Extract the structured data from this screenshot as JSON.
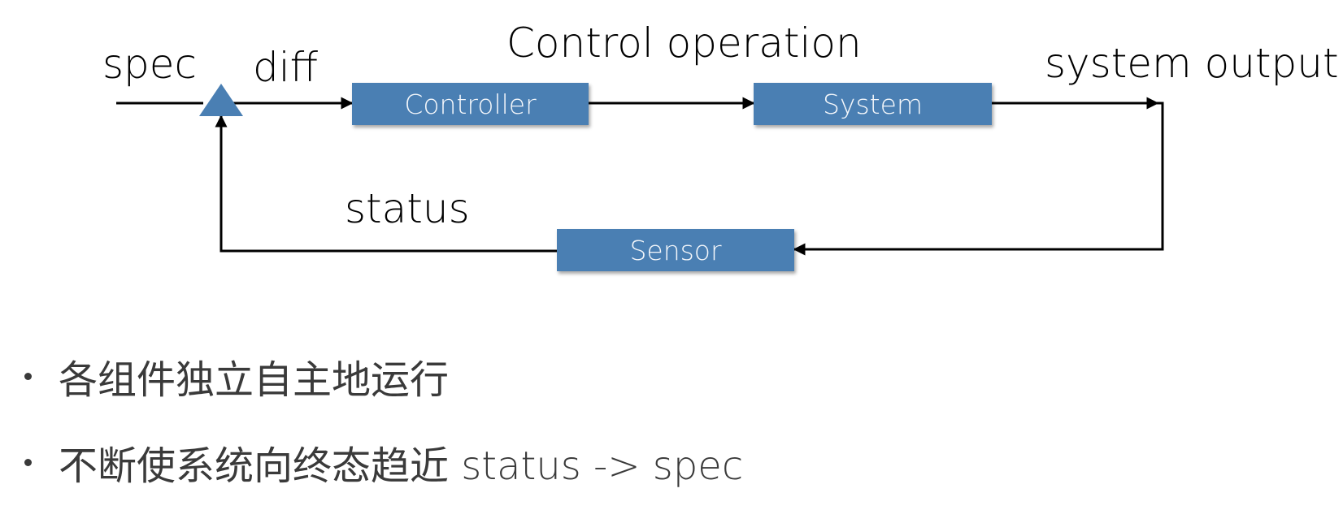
{
  "diagram": {
    "labels": {
      "spec": "spec",
      "diff": "diff",
      "control_operation": "Control operation",
      "system_output": "system output",
      "status": "status"
    },
    "blocks": {
      "controller": "Controller",
      "system": "System",
      "sensor": "Sensor"
    },
    "colors": {
      "block_fill": "#4a7fb3",
      "block_text": "#f4f7fb",
      "line": "#000000",
      "bullet_text": "#3a3a3a"
    }
  },
  "bullets": [
    "各组件独立自主地运行",
    "不断使系统向终态趋近 status -> spec"
  ]
}
